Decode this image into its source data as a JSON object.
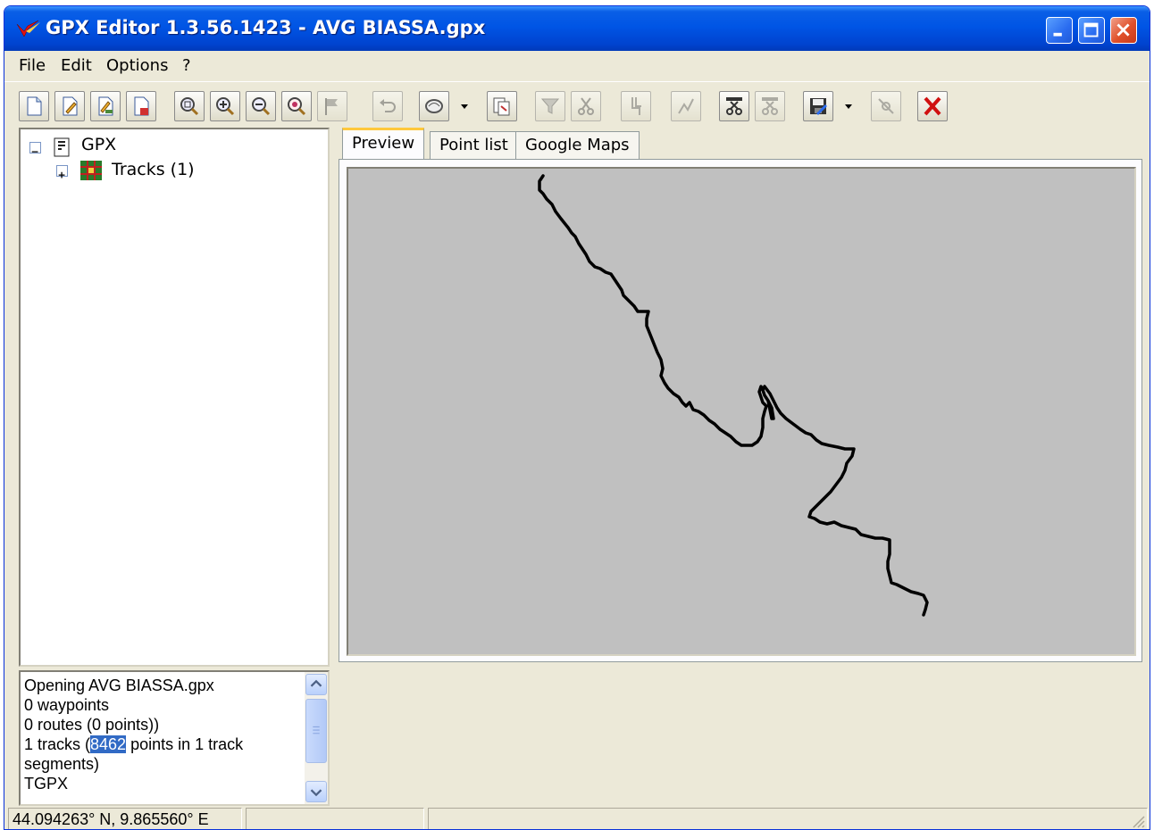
{
  "window": {
    "title": "GPX Editor 1.3.56.1423 - AVG BIASSA.gpx",
    "controls": [
      "minimize",
      "maximize",
      "close"
    ]
  },
  "menu": {
    "items": [
      "File",
      "Edit",
      "Options",
      "?"
    ]
  },
  "toolbar": {
    "buttons": [
      "new-file-icon",
      "edit-file-icon",
      "edit-properties-icon",
      "save-file-icon",
      "zoom-fit-icon",
      "zoom-in-icon",
      "zoom-out-icon",
      "zoom-selection-icon",
      "flag-icon",
      "undo-icon",
      "map-layer-icon",
      "export-icon",
      "filter-icon",
      "cut-track-icon",
      "join-icon",
      "simplify-icon",
      "split-icon",
      "merge-icon",
      "save-as-icon",
      "link-icon",
      "delete-icon"
    ]
  },
  "tree": {
    "root": {
      "label": "GPX",
      "icon": "gpx-document-icon",
      "expanded": true
    },
    "children": [
      {
        "label": "Tracks (1)",
        "icon": "tracks-grid-icon",
        "expanded": false
      }
    ]
  },
  "log": {
    "lines": [
      "Opening AVG BIASSA.gpx",
      "0 waypoints",
      "0 routes (0 points))",
      "1 tracks (",
      "8462",
      " points in 1 track",
      "segments)",
      "TGPX"
    ]
  },
  "tabs": [
    {
      "label": "Preview",
      "active": true
    },
    {
      "label": "Point list",
      "active": false
    },
    {
      "label": "Google Maps",
      "active": false
    }
  ],
  "preview": {
    "background": "#c0c0c0",
    "track_color": "#000000"
  },
  "status": {
    "coordinates": "44.094263° N, 9.865560° E",
    "panel2": "",
    "panel3": ""
  }
}
